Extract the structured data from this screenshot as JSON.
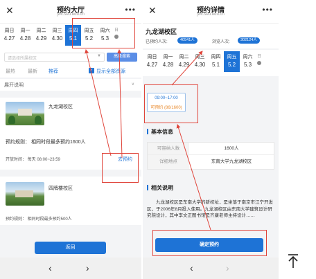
{
  "left": {
    "title": "预约大厅",
    "url": "jwc.seu.edu.cn",
    "week": [
      {
        "label": "周日",
        "date": "4.27"
      },
      {
        "label": "周一",
        "date": "4.28"
      },
      {
        "label": "周二",
        "date": "4.29"
      },
      {
        "label": "周三",
        "date": "4.30"
      },
      {
        "label": "周四",
        "date": "5.1",
        "selected": true
      },
      {
        "label": "周五",
        "date": "5.2"
      },
      {
        "label": "周六",
        "date": "5.3"
      }
    ],
    "week_more": "日",
    "search_placeholder": "请选择所属校区",
    "adv_search": "高级搜索",
    "filters": {
      "first": "最热",
      "second": "最新",
      "third": "推荐"
    },
    "show_all": "显示全部资源",
    "expand_label": "展开说明",
    "card1": {
      "name": "九龙湖校区",
      "rule": "预约规则：  相同时段最多预约1600人",
      "hours": "开放时间：  每天 08:00~23:59",
      "link": "去预约"
    },
    "card2": {
      "name": "四牌楼校区",
      "rule": "预约规则：  相同时段最多预约500人"
    },
    "bottom_button": "返回",
    "nav_back": "‹",
    "nav_forward": "›"
  },
  "right": {
    "title": "预约详情",
    "url": "jwc.seu.edu.cn",
    "campus": "九龙湖校区",
    "booked_label": "已预约人次:",
    "booked_value": "40541人",
    "visit_label": "浏览人次:",
    "visit_value": "302124人",
    "week": [
      {
        "label": "周日",
        "date": "4.27"
      },
      {
        "label": "周一",
        "date": "4.28"
      },
      {
        "label": "周二",
        "date": "4.29"
      },
      {
        "label": "周三",
        "date": "4.30"
      },
      {
        "label": "周四",
        "date": "5.1"
      },
      {
        "label": "周五",
        "date": "5.2",
        "selected": true
      },
      {
        "label": "周六",
        "date": "5.3"
      }
    ],
    "week_more": "日",
    "slot_time": "09:00~17:00",
    "slot_avail": "可预约 (86/1600)",
    "basic_info_title": "基本信息",
    "info_rows": [
      {
        "key": "可容纳人数",
        "value": "1600人"
      },
      {
        "key": "详细地点",
        "value": "东南大学九龙湖校区"
      }
    ],
    "desc_title": "相关说明",
    "description": "九龙湖校区是东南大学的新校址，是坐落于南京市江宁开发区，于2006年8月投入使用。九龙湖校区由东南大学建筑设计研究院设计，其中李文正图书馆是齐康老师主持设计……",
    "confirm_button": "确定预约",
    "nav_back": "‹",
    "nav_forward": "›"
  },
  "back_to_top": "个",
  "colors": {
    "accent": "#1e73d6",
    "highlight": "#e0453b",
    "warning": "#e98a2c"
  }
}
